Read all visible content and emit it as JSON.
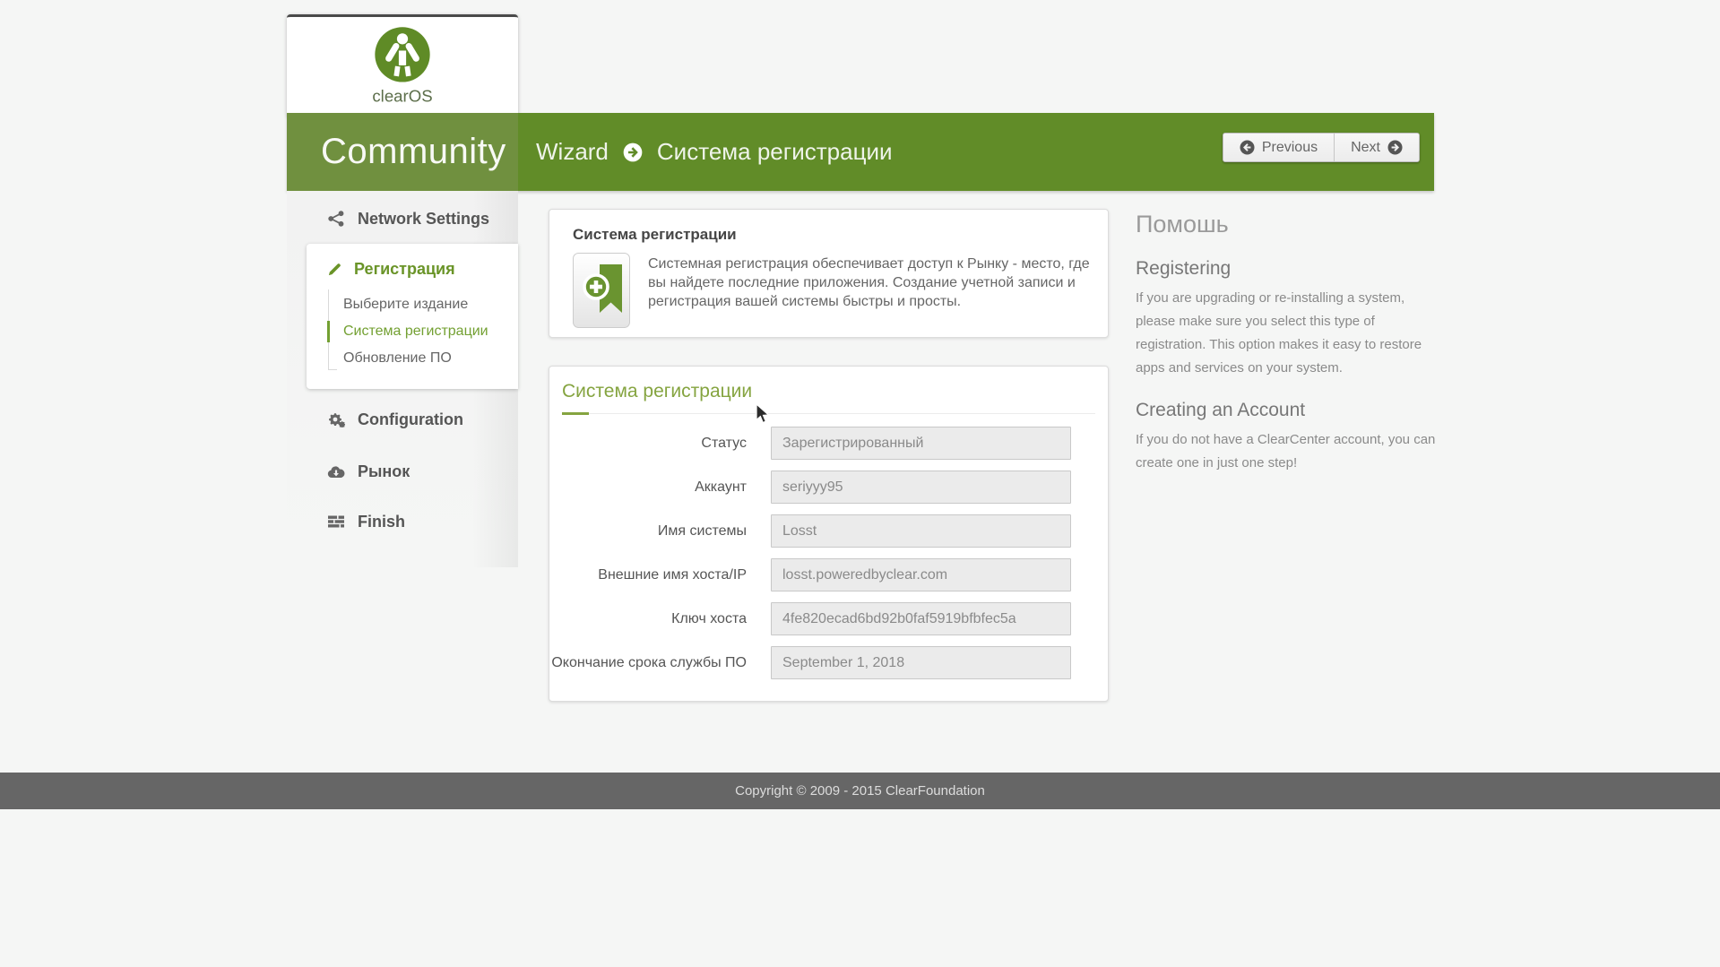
{
  "logo": {
    "brand": "clearOS"
  },
  "header": {
    "community_label": "Community",
    "breadcrumb": {
      "wizard": "Wizard",
      "page": "Система регистрации"
    },
    "previous_label": "Previous",
    "next_label": "Next"
  },
  "sidebar": {
    "items": [
      {
        "label": "Network Settings",
        "icon": "share-icon"
      },
      {
        "label": "Регистрация",
        "icon": "pencil-icon",
        "children": [
          "Выберите издание",
          "Система регистрации",
          "Обновление ПО"
        ],
        "active_child": "Система регистрации"
      },
      {
        "label": "Configuration",
        "icon": "gears-icon"
      },
      {
        "label": "Рынок",
        "icon": "cloud-download-icon"
      },
      {
        "label": "Finish",
        "icon": "tasks-icon"
      }
    ]
  },
  "intro_card": {
    "title": "Система регистрации",
    "description": "Системная регистрация обеспечивает доступ к Рынку - место, где вы найдете последние приложения. Создание учетной записи и регистрация вашей системы быстры и просты.",
    "icon": "bookmark-plus-icon"
  },
  "form_card": {
    "title": "Система регистрации",
    "fields": [
      {
        "label": "Статус",
        "value": "Зарегистрированный"
      },
      {
        "label": "Аккаунт",
        "value": "seriyyy95"
      },
      {
        "label": "Имя системы",
        "value": "Losst"
      },
      {
        "label": "Внешние имя хоста/IP",
        "value": "losst.poweredbyclear.com"
      },
      {
        "label": "Ключ хоста",
        "value": "4fe820ecad6bd92b0faf5919bfbfec5a"
      },
      {
        "label": "Окончание срока службы ПО",
        "value": "September 1, 2018"
      }
    ]
  },
  "help": {
    "title": "Помошь",
    "sections": [
      {
        "heading": "Registering",
        "text": "If you are upgrading or re-installing a system, please make sure you select this type of registration. This option makes it easy to restore apps and services on your system."
      },
      {
        "heading": "Creating an Account",
        "text": "If you do not have a ClearCenter account, you can create one in just one step!"
      }
    ]
  },
  "footer": {
    "copyright": "Copyright © 2009 - 2015 ClearFoundation"
  },
  "colors": {
    "header_green_left": "#70903f",
    "header_green_right": "#618c28",
    "accent_green": "#6a9428",
    "title_green": "#85a440",
    "footer_gray": "#666666",
    "page_bg": "#f5f6f5"
  }
}
